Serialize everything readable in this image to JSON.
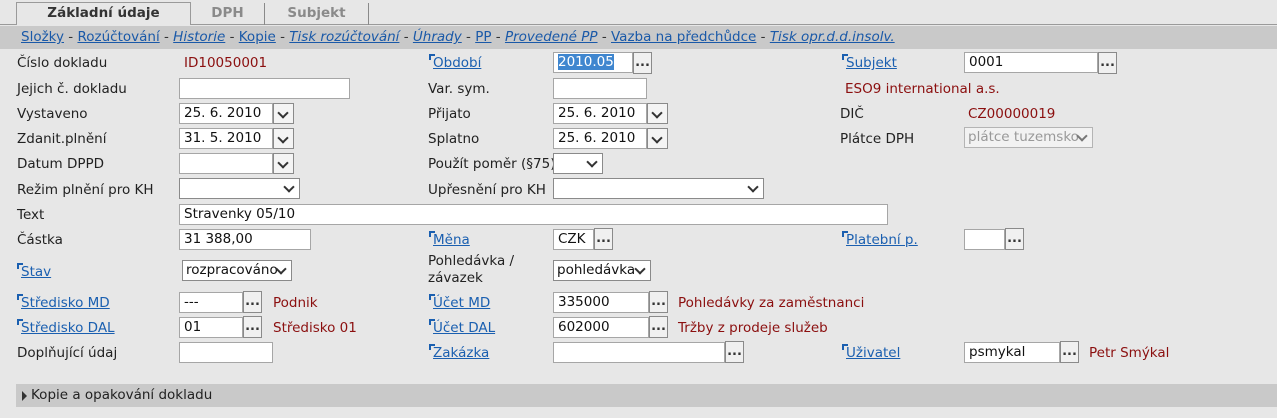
{
  "tabs": [
    "Základní údaje",
    "DPH",
    "Subjekt"
  ],
  "links": [
    {
      "label": "Složky",
      "italic": false
    },
    {
      "label": "Rozúčtování",
      "italic": false
    },
    {
      "label": "Historie",
      "italic": true
    },
    {
      "label": "Kopie",
      "italic": false
    },
    {
      "label": "Tisk rozúčtování",
      "italic": true
    },
    {
      "label": "Úhrady",
      "italic": true
    },
    {
      "label": "PP",
      "italic": false
    },
    {
      "label": "Provedené PP",
      "italic": true
    },
    {
      "label": "Vazba na předchůdce",
      "italic": false
    },
    {
      "label": "Tisk opr.d.d.insolv.",
      "italic": true
    }
  ],
  "link_separator": "-",
  "form": {
    "cislo_dokladu": {
      "label": "Číslo dokladu",
      "value": "ID10050001"
    },
    "jejich_dokladu": {
      "label": "Jejich č. dokladu",
      "value": ""
    },
    "vystaveno": {
      "label": "Vystaveno",
      "value": "25. 6. 2010"
    },
    "zdanit": {
      "label": "Zdanit.plnění",
      "value": "31. 5. 2010"
    },
    "datum_dppd": {
      "label": "Datum DPPD",
      "value": ""
    },
    "rezim_kh": {
      "label": "Režim plnění pro KH",
      "value": ""
    },
    "text": {
      "label": "Text",
      "value": "Stravenky 05/10"
    },
    "castka": {
      "label": "Částka",
      "value": "31 388,00"
    },
    "stav": {
      "label": "Stav",
      "value": "rozpracováno"
    },
    "stredisko_md": {
      "label": "Středisko MD",
      "value": "---",
      "desc": "Podnik"
    },
    "stredisko_dal": {
      "label": "Středisko DAL",
      "value": "01",
      "desc": "Středisko 01"
    },
    "doplnujici": {
      "label": "Doplňující údaj",
      "value": ""
    },
    "obdobi": {
      "label": "Období",
      "value": "2010.05"
    },
    "var_sym": {
      "label": "Var. sym.",
      "value": ""
    },
    "prijato": {
      "label": "Přijato",
      "value": "25. 6. 2010"
    },
    "splatno": {
      "label": "Splatno",
      "value": "25. 6. 2010"
    },
    "pouzit_pomer": {
      "label": "Použít poměr (§75)",
      "value": ""
    },
    "upresneni_kh": {
      "label": "Upřesnění pro KH",
      "value": ""
    },
    "mena": {
      "label": "Měna",
      "value": "CZK"
    },
    "pohledavka": {
      "label": "Pohledávka / závazek",
      "value": "pohledávka"
    },
    "ucet_md": {
      "label": "Účet MD",
      "value": "335000",
      "desc": "Pohledávky za zaměstnanci"
    },
    "ucet_dal": {
      "label": "Účet DAL",
      "value": "602000",
      "desc": "Tržby z prodeje služeb"
    },
    "zakazka": {
      "label": "Zakázka",
      "value": ""
    },
    "subjekt": {
      "label": "Subjekt",
      "value": "0001",
      "desc": "ESO9 international a.s."
    },
    "dic": {
      "label": "DIČ",
      "value": "CZ00000019"
    },
    "platce_dph": {
      "label": "Plátce DPH",
      "value": "plátce tuzemsko"
    },
    "platebni_p": {
      "label": "Platební p.",
      "value": ""
    },
    "uzivatel": {
      "label": "Uživatel",
      "value": "psmykal",
      "desc": "Petr Smýkal"
    }
  },
  "dots_label": "...",
  "footer": {
    "label": "Kopie a opakování dokladu"
  }
}
